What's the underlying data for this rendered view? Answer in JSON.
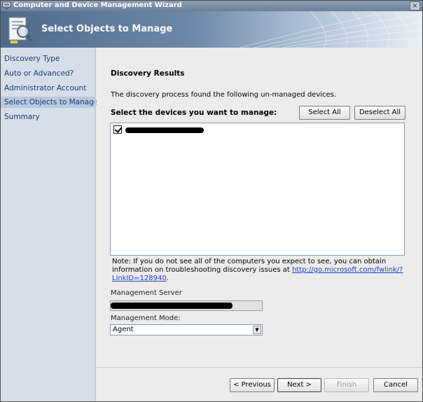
{
  "window": {
    "title": "Computer and Device Management Wizard",
    "close_glyph": "×"
  },
  "header": {
    "title": "Select Objects to Manage",
    "icon": "wizard-magnifier-icon"
  },
  "nav": {
    "items": [
      {
        "label": "Discovery Type"
      },
      {
        "label": "Auto or Advanced?"
      },
      {
        "label": "Administrator Account"
      },
      {
        "label": "Select Objects to Manage",
        "active": true
      },
      {
        "label": "Summary"
      }
    ]
  },
  "main": {
    "heading": "Discovery Results",
    "intro": "The discovery process found the following un-managed devices.",
    "select_label": "Select the devices you want to manage:",
    "select_all_label": "Select All",
    "deselect_all_label": "Deselect All",
    "devices": [
      {
        "checked": true
      }
    ],
    "note_text": "Note: If you do not see all of the computers you expect to see, you can obtain information on troubleshooting discovery issues at ",
    "note_link": "http://go.microsoft.com/fwlink/?LinkID=128940",
    "note_end": ".",
    "management_server_label": "Management Server",
    "management_mode_label": "Management Mode:",
    "management_mode_value": "Agent"
  },
  "footer": {
    "previous_label": "< Previous",
    "next_label": "Next >",
    "finish_label": "Finish",
    "cancel_label": "Cancel"
  }
}
